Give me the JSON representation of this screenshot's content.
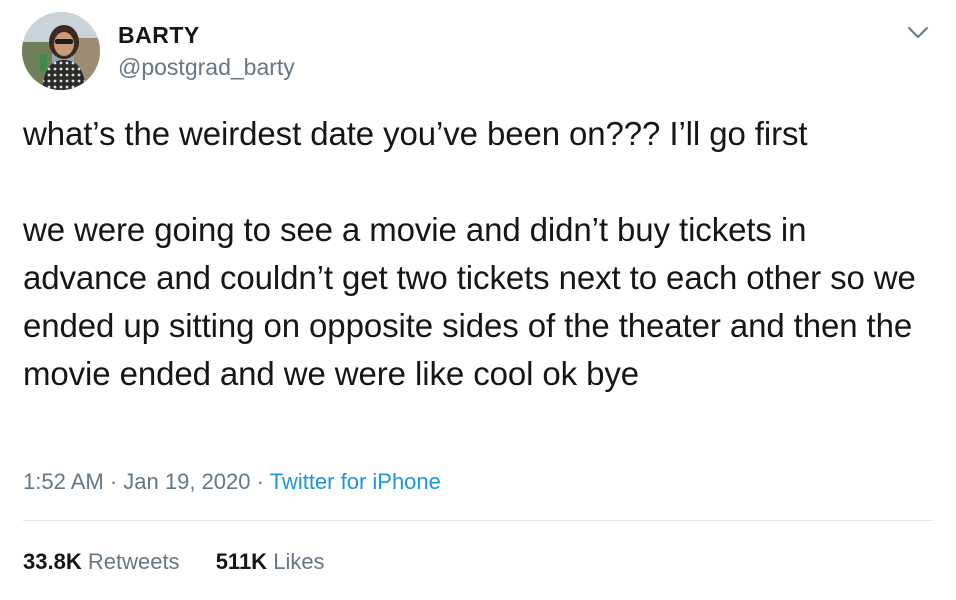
{
  "author": {
    "display_name": "BARTY",
    "handle": "@postgrad_barty"
  },
  "tweet": {
    "text": "what’s the weirdest date you’ve been on??? I’ll go first\n\nwe were going to see a movie and didn’t buy tickets in advance and couldn’t get two tickets next to each other so we ended up sitting on opposite sides of the theater and then the movie ended and we were like cool ok bye",
    "time": "1:52 AM",
    "separator": "·",
    "date": "Jan 19, 2020",
    "source": "Twitter for iPhone"
  },
  "stats": {
    "retweets_count": "33.8K",
    "retweets_label": "Retweets",
    "likes_count": "511K",
    "likes_label": "Likes"
  },
  "icons": {
    "more": "chevron-down-icon"
  },
  "colors": {
    "text": "#14171a",
    "secondary": "#657786",
    "link": "#1b95e0",
    "divider": "#e1e8ed"
  }
}
